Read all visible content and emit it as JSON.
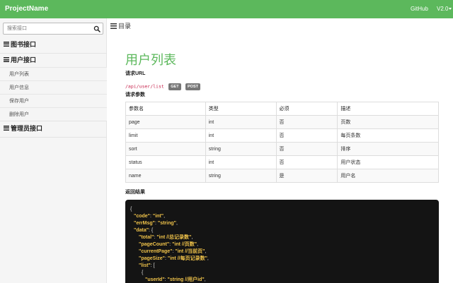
{
  "navbar": {
    "brand": "ProjectName",
    "github": "GitHub",
    "version": "V2.0"
  },
  "sidebar": {
    "search_placeholder": "搜索接口",
    "groups": [
      {
        "label": "图书接口"
      },
      {
        "label": "用户接口",
        "items": [
          {
            "label": "用户列表"
          },
          {
            "label": "用户信息"
          },
          {
            "label": "保存用户"
          },
          {
            "label": "删除用户"
          }
        ]
      },
      {
        "label": "管理员接口"
      }
    ]
  },
  "main": {
    "toc": "目录",
    "title": "用户列表",
    "request_url_label": "请求URL",
    "url": "/api/user/list",
    "methods": [
      "GET",
      "POST"
    ],
    "params_label": "请求参数",
    "table": {
      "headers": [
        "参数名",
        "类型",
        "必须",
        "描述"
      ],
      "rows": [
        [
          "page",
          "int",
          "否",
          "页数"
        ],
        [
          "limit",
          "int",
          "否",
          "每页条数"
        ],
        [
          "sort",
          "string",
          "否",
          "排序"
        ],
        [
          "status",
          "int",
          "否",
          "用户状态"
        ],
        [
          "name",
          "string",
          "是",
          "用户名"
        ]
      ]
    },
    "result_label": "返回结果",
    "code_lines": [
      [
        "",
        "{"
      ],
      [
        "\"code\"",
        ": ",
        "\"int\"",
        ","
      ],
      [
        "\"errMsg\"",
        ": ",
        "\"string\"",
        ","
      ],
      [
        "\"data\"",
        ": {"
      ],
      [
        "\"total\"",
        ": ",
        "\"int //总记录数\"",
        ","
      ],
      [
        "\"pageCount\"",
        ": ",
        "\"int //页数\"",
        ","
      ],
      [
        "\"currentPage\"",
        ": ",
        "\"int //当前页\"",
        ","
      ],
      [
        "\"pageSize\"",
        ": ",
        "\"int //每页记录数\"",
        ","
      ],
      [
        "\"list\"",
        ": ["
      ],
      [
        "",
        "{"
      ],
      [
        "\"userId\"",
        ": ",
        "\"string //用户id\"",
        ","
      ]
    ]
  },
  "colors": {
    "accent": "#5cb85c",
    "code_bg": "#141414",
    "code_key": "#f0c34a",
    "url_code": "#c7254e",
    "badge": "#777777"
  }
}
